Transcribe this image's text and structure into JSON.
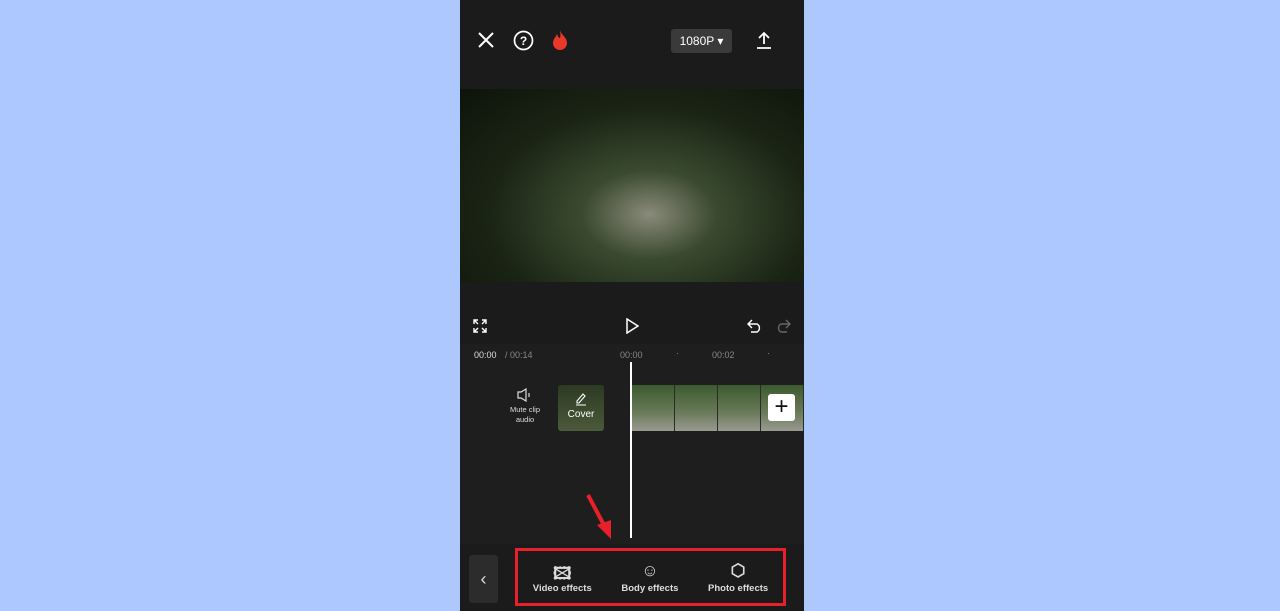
{
  "topbar": {
    "resolution": "1080P",
    "icons": [
      "close-icon",
      "help-icon",
      "flame-icon",
      "export-icon"
    ]
  },
  "controls": {
    "icons": [
      "fullscreen-icon",
      "play-icon",
      "undo-icon",
      "redo-icon"
    ]
  },
  "timeline": {
    "current_time": "00:00",
    "total_time": "/ 00:14",
    "ruler": [
      "00:00",
      "00:02"
    ],
    "mute_label": "Mute clip audio",
    "cover_label": "Cover",
    "add_label": "+"
  },
  "toolbar": {
    "back": "‹",
    "items": [
      {
        "label": "Video effects",
        "icon": "video-effects-icon"
      },
      {
        "label": "Body effects",
        "icon": "body-effects-icon"
      },
      {
        "label": "Photo effects",
        "icon": "photo-effects-icon"
      }
    ]
  },
  "colors": {
    "highlight": "#e8202a",
    "background": "#adc8ff",
    "flame": "#e8382a"
  }
}
